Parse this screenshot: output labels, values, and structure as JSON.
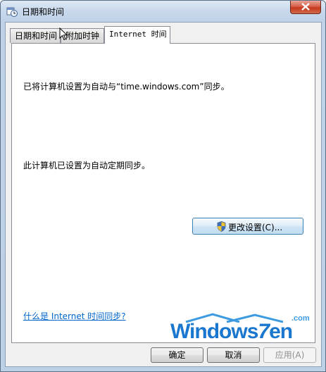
{
  "window": {
    "title": "日期和时间"
  },
  "tabs": [
    {
      "label": "日期和时间",
      "active": false
    },
    {
      "label": "附加时钟",
      "active": false
    },
    {
      "label": "Internet 时间",
      "active": true
    }
  ],
  "panel": {
    "sync_server_text": "已将计算机设置为自动与“time.windows.com”同步。",
    "schedule_text": "此计算机已设置为自动定期同步。",
    "change_settings_label": "更改设置(C)...",
    "help_link": "什么是 Internet 时间同步?"
  },
  "watermark": {
    "main_prefix": "Windows",
    "main_seven": "7",
    "main_suffix": "en",
    "domain": ".com"
  },
  "buttons": {
    "ok": "确定",
    "cancel": "取消",
    "apply": "应用(A)"
  },
  "colors": {
    "link": "#0066cc",
    "close_button": "#c4391c",
    "watermark": "#1a77cf"
  },
  "icons": {
    "title": "clock-calendar-icon",
    "close": "close-icon",
    "uac": "uac-shield-icon",
    "cursor": "mouse-pointer-icon"
  }
}
